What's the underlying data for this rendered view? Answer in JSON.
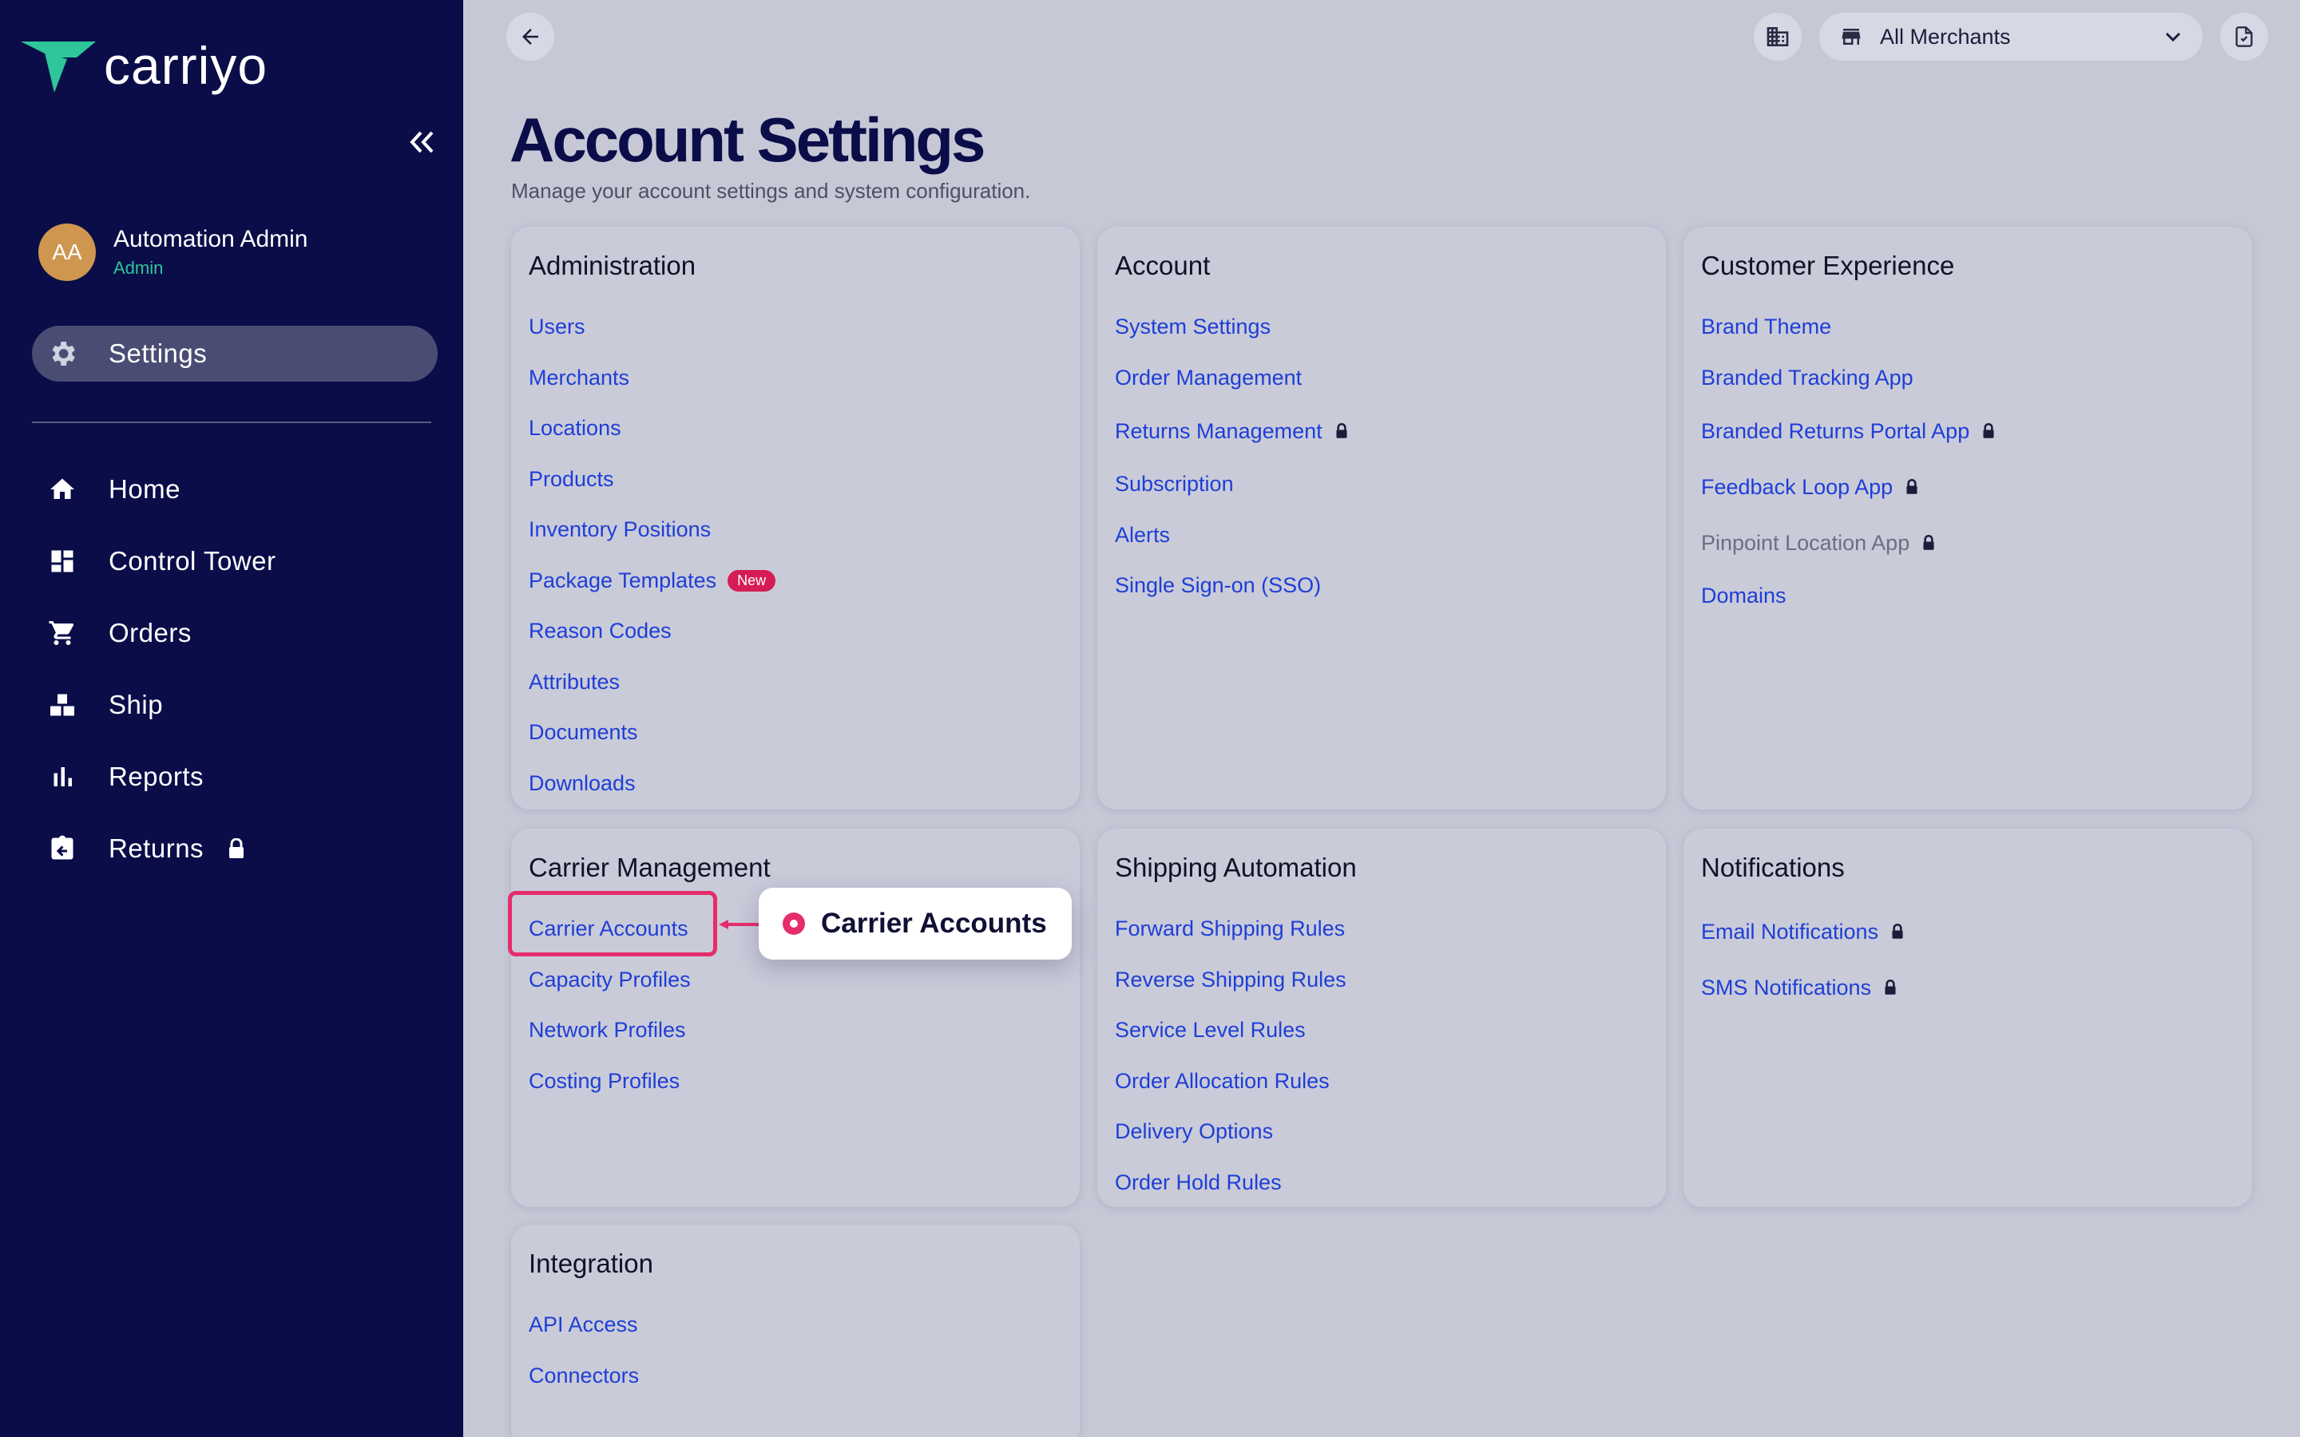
{
  "app": {
    "brand": "carriyo"
  },
  "sidebar": {
    "user": {
      "initials": "AA",
      "name": "Automation Admin",
      "role": "Admin"
    },
    "active": {
      "label": "Settings",
      "icon": "gear-icon"
    },
    "items": [
      {
        "label": "Home",
        "icon": "home-icon",
        "locked": false
      },
      {
        "label": "Control Tower",
        "icon": "dashboard-icon",
        "locked": false
      },
      {
        "label": "Orders",
        "icon": "cart-icon",
        "locked": false
      },
      {
        "label": "Ship",
        "icon": "boxes-icon",
        "locked": false
      },
      {
        "label": "Reports",
        "icon": "bar-chart-icon",
        "locked": false
      },
      {
        "label": "Returns",
        "icon": "return-box-icon",
        "locked": true
      }
    ]
  },
  "topbar": {
    "merchant_select": "All Merchants"
  },
  "header": {
    "title": "Account Settings",
    "subtitle": "Manage your account settings and system configuration."
  },
  "cards": {
    "administration": {
      "title": "Administration",
      "links": [
        "Users",
        "Merchants",
        "Locations",
        "Products",
        "Inventory Positions",
        "Package Templates",
        "Reason Codes",
        "Attributes",
        "Documents",
        "Downloads"
      ],
      "package_badge": "New"
    },
    "account": {
      "title": "Account",
      "links": [
        "System Settings",
        "Order Management",
        "Returns Management",
        "Subscription",
        "Alerts",
        "Single Sign-on (SSO)"
      ]
    },
    "customer_experience": {
      "title": "Customer Experience",
      "links": [
        "Brand Theme",
        "Branded Tracking App",
        "Branded Returns Portal App",
        "Feedback Loop App",
        "Pinpoint Location App",
        "Domains"
      ]
    },
    "carrier_management": {
      "title": "Carrier Management",
      "links": [
        "Carrier Accounts",
        "Capacity Profiles",
        "Network Profiles",
        "Costing Profiles"
      ]
    },
    "shipping_automation": {
      "title": "Shipping Automation",
      "links": [
        "Forward Shipping Rules",
        "Reverse Shipping Rules",
        "Service Level Rules",
        "Order Allocation Rules",
        "Delivery Options",
        "Order Hold Rules"
      ]
    },
    "notifications": {
      "title": "Notifications",
      "links": [
        "Email Notifications",
        "SMS Notifications"
      ]
    },
    "integration": {
      "title": "Integration",
      "links": [
        "API Access",
        "Connectors"
      ]
    }
  },
  "callout": {
    "label": "Carrier Accounts"
  },
  "colors": {
    "sidebar_bg": "#0a0d48",
    "page_bg": "#c6c8d6",
    "link": "#1f3ed6",
    "accent": "#e62d6b",
    "brand_green": "#2fc59a"
  }
}
